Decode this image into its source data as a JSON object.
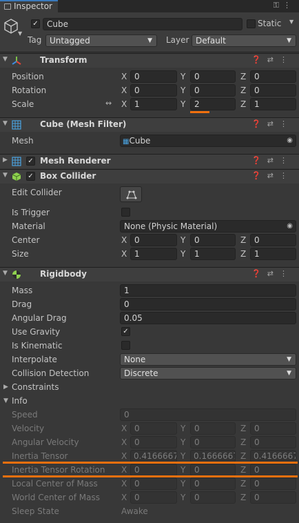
{
  "tab": {
    "label": "Inspector"
  },
  "header": {
    "name": "Cube",
    "static_label": "Static",
    "tag_label": "Tag",
    "tag_value": "Untagged",
    "layer_label": "Layer",
    "layer_value": "Default"
  },
  "axes": {
    "x": "X",
    "y": "Y",
    "z": "Z"
  },
  "transform": {
    "title": "Transform",
    "position": {
      "label": "Position",
      "x": "0",
      "y": "0",
      "z": "0"
    },
    "rotation": {
      "label": "Rotation",
      "x": "0",
      "y": "0",
      "z": "0"
    },
    "scale": {
      "label": "Scale",
      "x": "1",
      "y": "2",
      "z": "1"
    }
  },
  "mesh_filter": {
    "title": "Cube (Mesh Filter)",
    "mesh_label": "Mesh",
    "mesh_value": "Cube"
  },
  "mesh_renderer": {
    "title": "Mesh Renderer"
  },
  "box_collider": {
    "title": "Box Collider",
    "edit_label": "Edit Collider",
    "trigger_label": "Is Trigger",
    "material_label": "Material",
    "material_value": "None (Physic Material)",
    "center": {
      "label": "Center",
      "x": "0",
      "y": "0",
      "z": "0"
    },
    "size": {
      "label": "Size",
      "x": "1",
      "y": "1",
      "z": "1"
    }
  },
  "rigidbody": {
    "title": "Rigidbody",
    "mass": {
      "label": "Mass",
      "value": "1"
    },
    "drag": {
      "label": "Drag",
      "value": "0"
    },
    "angular_drag": {
      "label": "Angular Drag",
      "value": "0.05"
    },
    "use_gravity": {
      "label": "Use Gravity",
      "checked": true
    },
    "is_kinematic": {
      "label": "Is Kinematic",
      "checked": false
    },
    "interpolate": {
      "label": "Interpolate",
      "value": "None"
    },
    "collision": {
      "label": "Collision Detection",
      "value": "Discrete"
    },
    "constraints_label": "Constraints",
    "info_label": "Info",
    "speed": {
      "label": "Speed",
      "value": "0"
    },
    "velocity": {
      "label": "Velocity",
      "x": "0",
      "y": "0",
      "z": "0"
    },
    "angular_velocity": {
      "label": "Angular Velocity",
      "x": "0",
      "y": "0",
      "z": "0"
    },
    "inertia_tensor": {
      "label": "Inertia Tensor",
      "x": "0.4166667",
      "y": "0.1666667",
      "z": "0.4166667"
    },
    "inertia_rotation": {
      "label": "Inertia Tensor Rotation",
      "x": "0",
      "y": "0",
      "z": "0"
    },
    "local_com": {
      "label": "Local Center of Mass",
      "x": "0",
      "y": "0",
      "z": "0"
    },
    "world_com": {
      "label": "World Center of Mass",
      "x": "0",
      "y": "0",
      "z": "0"
    },
    "sleep": {
      "label": "Sleep State",
      "value": "Awake"
    }
  },
  "colors": {
    "accent": "#f0700e",
    "tab_highlight": "#3a79bb",
    "background": "#383838"
  }
}
